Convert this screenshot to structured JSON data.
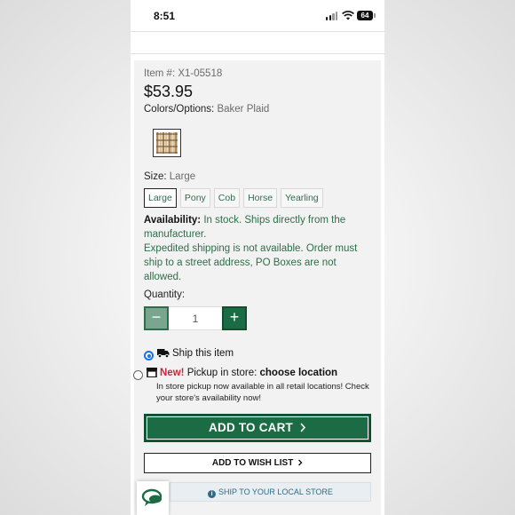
{
  "status_bar": {
    "time": "8:51",
    "battery": "64"
  },
  "product": {
    "item_label": "Item #:",
    "item_number": "X1-05518",
    "price": "$53.95",
    "colors_label": "Colors/Options:",
    "colors_value": "Baker Plaid",
    "size_label": "Size:",
    "size_value": "Large",
    "sizes": [
      "Large",
      "Pony",
      "Cob",
      "Horse",
      "Yearling"
    ],
    "availability_label": "Availability:",
    "availability_text": "In stock. Ships directly from the manufacturer.",
    "shipping_note": "Expedited shipping is not available. Order must ship to a street address, PO Boxes are not allowed.",
    "quantity_label": "Quantity:",
    "quantity_value": "1"
  },
  "fulfillment": {
    "ship_label": "Ship this item",
    "pickup_new": "New!",
    "pickup_label": "Pickup in store:",
    "pickup_link": "choose location",
    "pickup_note": "In store pickup now available in all retail locations! Check your store's availability now!"
  },
  "actions": {
    "add_to_cart": "ADD TO CART",
    "add_to_wishlist": "ADD TO WISH LIST",
    "ship_local": "SHIP TO YOUR LOCAL STORE"
  },
  "colors": {
    "brand_green": "#1b6b45",
    "text_green": "#2e6d4a",
    "new_red": "#c6283b",
    "radio_blue": "#1a73e8"
  }
}
